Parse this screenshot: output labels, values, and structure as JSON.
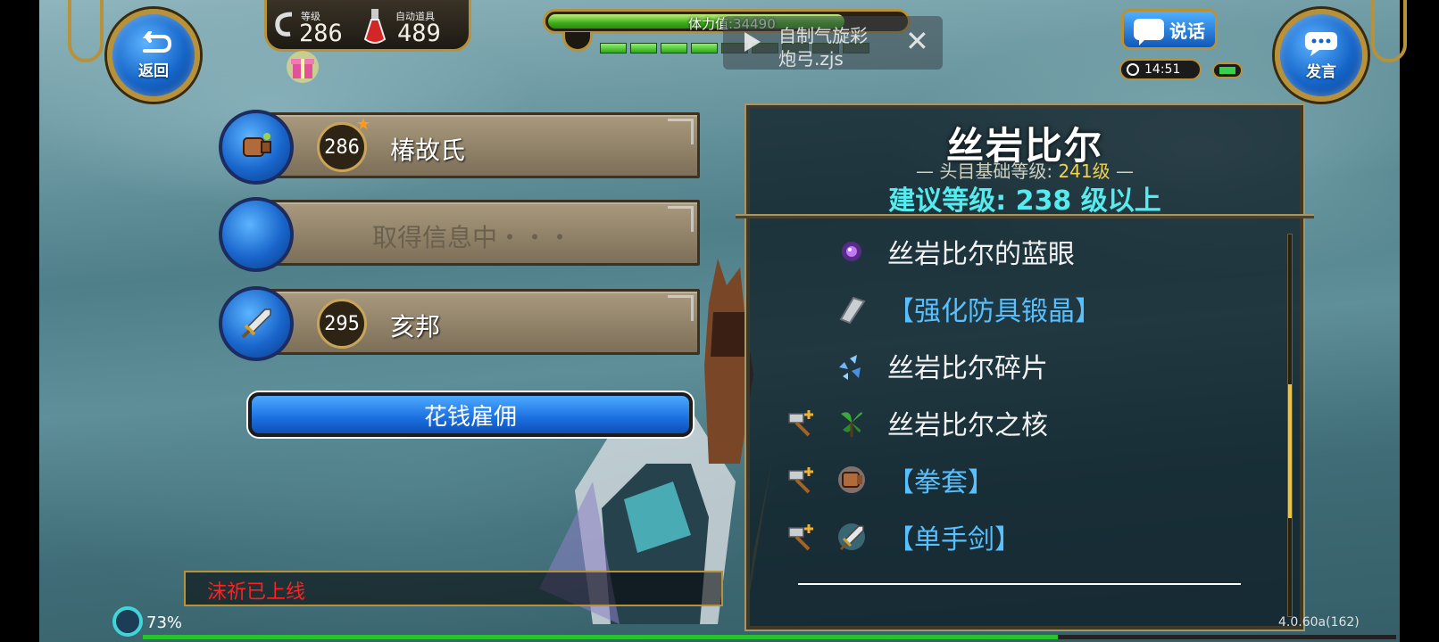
{
  "hud": {
    "back_label": "返回",
    "speak_label": "发言",
    "chat_label": "说话",
    "level_caption": "等级",
    "level_value": "286",
    "auto_item_caption": "自动道具",
    "auto_item_value": "489",
    "stamina_text": "体力值:34490",
    "stamina_fraction": 0.83,
    "clock": "14:51"
  },
  "toast": {
    "line1": "自制气旋彩",
    "line2": "炮弓.zjs",
    "close": "✕"
  },
  "party": [
    {
      "level": "286",
      "name": "椿故氏",
      "icon": "gauntlet-icon",
      "star": "★"
    },
    {
      "level": "",
      "name": "取得信息中・・・",
      "icon": "none"
    },
    {
      "level": "295",
      "name": "亥邦",
      "icon": "sword-icon"
    }
  ],
  "hire_button": "花钱雇佣",
  "boss": {
    "title": "丝岩比尔",
    "base_level_label": "— 头目基础等级: ",
    "base_level_value": "241级",
    "base_level_suffix": " —",
    "recommend": "建议等级: 238 级以上",
    "drops": [
      {
        "label": "丝岩比尔的蓝眼",
        "style": "white",
        "icon": "purple-orb-icon",
        "craftable": false
      },
      {
        "label": "【强化防具锻晶】",
        "style": "blue",
        "icon": "crystal-shard-icon",
        "craftable": false
      },
      {
        "label": "丝岩比尔碎片",
        "style": "white",
        "icon": "blue-fragments-icon",
        "craftable": false
      },
      {
        "label": "丝岩比尔之核",
        "style": "white",
        "icon": "green-leaf-icon",
        "craftable": true
      },
      {
        "label": "【拳套】",
        "style": "blue",
        "icon": "gauntlet-icon",
        "craftable": true
      },
      {
        "label": "【单手剑】",
        "style": "blue",
        "icon": "sword-icon",
        "craftable": true
      }
    ]
  },
  "chat_message": "沫祈已上线",
  "exp_percent": "73%",
  "version": "4.0.60a(162)",
  "colors": {
    "gold": "#b8923a",
    "blue_button": "#1a6fe0",
    "recommend_cyan": "#55ecf0",
    "item_blue": "#58c0ff",
    "online_red": "#ff2020"
  }
}
